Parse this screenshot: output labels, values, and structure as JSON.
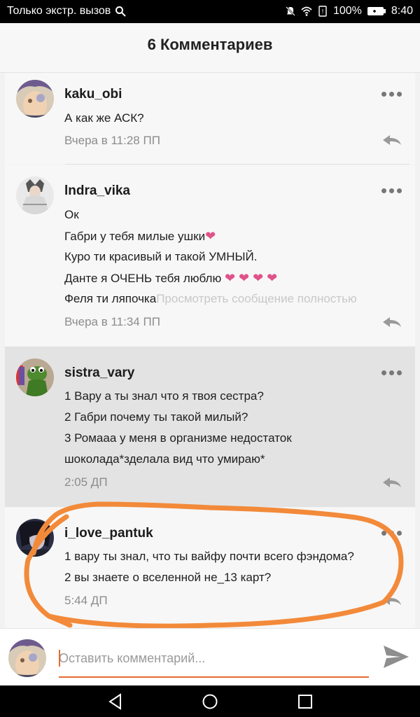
{
  "status_bar": {
    "left_text": "Только экстр. вызов",
    "battery": "100%",
    "time": "8:40"
  },
  "header": {
    "title": "6 Комментариев"
  },
  "comments": [
    {
      "username": "kaku_obi",
      "lines": [
        "А как же АСК?"
      ],
      "time": "Вчера в 11:28 ПП"
    },
    {
      "username": "lndra_vika",
      "lines": [
        "Ок",
        "Габри у тебя милые ушки",
        "Куро ти красивый и такой УМНЫЙ.",
        "Данте я ОЧЕНЬ тебя люблю",
        "Феля ти ляпочка"
      ],
      "hearts_line2": "❤",
      "hearts_line4": "❤ ❤ ❤ ❤",
      "see_more": "Просмотреть сообщение полностью",
      "time": "Вчера в 11:34 ПП"
    },
    {
      "username": "sistra_vary",
      "lines": [
        "1 Вару а ты знал что я твоя сестра?",
        "2 Габри почему ты такой милый?",
        "3 Ромааа у меня в организме недостаток",
        "шоколада*зделала вид что умираю*"
      ],
      "time": "2:05 ДП"
    },
    {
      "username": "i_love_pantuk",
      "lines": [
        "1 вару ты знал, что ты вайфу почти всего фэндома?",
        "2 вы знаете о вселенной не_13 карт?"
      ],
      "time": "5:44 ДП"
    }
  ],
  "input": {
    "placeholder": "Оставить комментарий..."
  },
  "colors": {
    "accent": "#e56b2f",
    "annotation": "#f28a3a",
    "highlight_bg": "#e4e3e3"
  },
  "icons": [
    "search-icon",
    "mute-icon",
    "wifi-icon",
    "battery-icon",
    "more-icon",
    "reply-icon",
    "send-icon",
    "back-icon",
    "home-icon",
    "recents-icon"
  ]
}
